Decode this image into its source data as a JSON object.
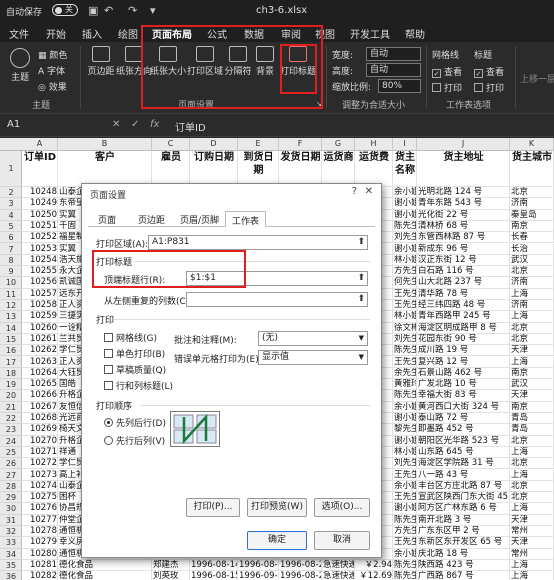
{
  "title_bar": {
    "autosave_label": "自动保存",
    "toggle_state": "关",
    "filename": "ch3-6.xlsx"
  },
  "tabs": [
    "文件",
    "开始",
    "插入",
    "绘图",
    "页面布局",
    "公式",
    "数据",
    "审阅",
    "视图",
    "开发工具",
    "帮助"
  ],
  "active_tab": "页面布局",
  "ribbon": {
    "theme_group": {
      "label": "主题",
      "buttons": [
        "主题",
        "颜色",
        "字体",
        "效果"
      ]
    },
    "page_setup_group": {
      "label": "页面设置",
      "buttons": [
        "页边距",
        "纸张方向",
        "纸张大小",
        "打印区域",
        "分隔符",
        "背景",
        "打印标题"
      ]
    },
    "scale_group": {
      "label": "调整为合适大小",
      "width_label": "宽度:",
      "width_value": "自动",
      "height_label": "高度:",
      "height_value": "自动",
      "scale_label": "缩放比例:",
      "scale_value": "80%"
    },
    "sheet_options_group": {
      "label": "工作表选项",
      "gridlines": "网格线",
      "headings": "标题",
      "view1": "查看",
      "view2": "查看",
      "print1": "打印",
      "print2": "打印"
    },
    "arrange": "上移一层"
  },
  "formula_bar": {
    "name_box": "A1",
    "fx": "fx",
    "value": "订单ID"
  },
  "columns": [
    "A",
    "B",
    "C",
    "D",
    "E",
    "F",
    "G",
    "H",
    "I",
    "J",
    "K"
  ],
  "header_row": [
    "订单ID",
    "客户",
    "雇员",
    "订购日期",
    "到货日期",
    "发货日期",
    "运货商",
    "运货费",
    "货主名称",
    "货主地址",
    "货主城市"
  ],
  "rows": [
    [
      "10248",
      "山泰企业",
      "",
      "",
      "",
      "",
      "",
      "",
      "余小姐",
      "光明北路 124 号",
      "北京"
    ],
    [
      "10249",
      "东帝望",
      "",
      "",
      "",
      "",
      "",
      "",
      "谢小姐",
      "青年东路 543 号",
      "济南"
    ],
    [
      "10250",
      "实翼",
      "",
      "",
      "",
      "",
      "",
      "",
      "谢小姐",
      "光化街 22 号",
      "秦皇岛"
    ],
    [
      "10251",
      "千固",
      "",
      "",
      "",
      "",
      "",
      "",
      "陈先生",
      "清林桥 68 号",
      "南京"
    ],
    [
      "10252",
      "福星制衣",
      "",
      "",
      "",
      "",
      "",
      "",
      "刘先生",
      "东管西林路 87 号",
      "长春"
    ],
    [
      "10253",
      "实翼",
      "",
      "",
      "",
      "",
      "",
      "",
      "谢小姐",
      "新成东 96 号",
      "长治"
    ],
    [
      "10254",
      "浩天旅行",
      "",
      "",
      "",
      "",
      "",
      "",
      "林小姐",
      "汉正东街 12 号",
      "武汉"
    ],
    [
      "10255",
      "永大企业",
      "",
      "",
      "",
      "",
      "",
      "",
      "方先生",
      "白石路 116 号",
      "北京"
    ],
    [
      "10256",
      "凯诚国际",
      "",
      "",
      "",
      "",
      "",
      "",
      "何先生",
      "山大北路 237 号",
      "济南"
    ],
    [
      "10257",
      "远东开发",
      "",
      "",
      "",
      "",
      "",
      "",
      "王先生",
      "清华路 78 号",
      "上海"
    ],
    [
      "10258",
      "正人资源",
      "",
      "",
      "",
      "",
      "",
      "",
      "王先生",
      "经三纬四路 48 号",
      "济南"
    ],
    [
      "10259",
      "三捷实业",
      "",
      "",
      "",
      "",
      "",
      "",
      "林小姐",
      "青年西路甲 245 号",
      "上海"
    ],
    [
      "10260",
      "一诠精密",
      "",
      "",
      "",
      "",
      "",
      "",
      "徐文彬",
      "海淀区明成路甲 8 号",
      "北京"
    ],
    [
      "10261",
      "兰共贸易",
      "",
      "",
      "",
      "",
      "",
      "",
      "刘先生",
      "花园东街 90 号",
      "北京"
    ],
    [
      "10262",
      "学仁贸易",
      "",
      "",
      "",
      "",
      "",
      "",
      "陈先生",
      "成川路 19 号",
      "天津"
    ],
    [
      "10263",
      "正人资源",
      "",
      "",
      "",
      "",
      "",
      "",
      "王先生",
      "复兴路 12 号",
      "上海"
    ],
    [
      "10264",
      "大钰贸易",
      "",
      "",
      "",
      "",
      "",
      "",
      "余先生",
      "石景山路 462 号",
      "南京"
    ],
    [
      "10265",
      "国皓",
      "",
      "",
      "",
      "",
      "",
      "",
      "黄雅玲",
      "广发北路 10 号",
      "武汉"
    ],
    [
      "10266",
      "升格企业",
      "",
      "",
      "",
      "",
      "",
      "",
      "陈先生",
      "幸福大街 83 号",
      "天津"
    ],
    [
      "10267",
      "友恒信托",
      "",
      "",
      "",
      "",
      "",
      "",
      "余小姐",
      "黄河西口大街 324 号",
      "南京"
    ],
    [
      "10268",
      "光远商贸",
      "",
      "",
      "",
      "",
      "",
      "",
      "谢小姐",
      "泰山路 72 号",
      "青岛"
    ],
    [
      "10269",
      "椅天文化",
      "",
      "",
      "",
      "",
      "",
      "",
      "黎先生",
      "即墨路 452 号",
      "青岛"
    ],
    [
      "10270",
      "升格企业",
      "",
      "",
      "",
      "",
      "",
      "",
      "谢小姐",
      "朝阳区光华路 523 号",
      "北京"
    ],
    [
      "10271",
      "祥通",
      "",
      "",
      "",
      "",
      "",
      "",
      "林小姐",
      "山东路 645 号",
      "上海"
    ],
    [
      "10272",
      "学仁贸易",
      "",
      "",
      "",
      "",
      "",
      "",
      "刘先生",
      "海淀区学院路 31 号",
      "北京"
    ],
    [
      "10273",
      "高上补子",
      "",
      "",
      "",
      "",
      "",
      "",
      "王先生",
      "八一路 43 号",
      "上海"
    ],
    [
      "10274",
      "山泰企业",
      "",
      "",
      "",
      "",
      "",
      "",
      "余小姐",
      "丰台区方庄北路 87 号",
      "北京"
    ],
    [
      "10275",
      "困杯",
      "",
      "",
      "",
      "",
      "",
      "",
      "王先生",
      "宣武区陕西门东大街 45 号",
      "北京"
    ],
    [
      "10276",
      "协昌规能",
      "",
      "",
      "",
      "",
      "",
      "",
      "谢小姐",
      "阿方区广林东路 6 号",
      "上海"
    ],
    [
      "10277",
      "仲堂企业",
      "",
      "",
      "",
      "",
      "",
      "",
      "陈先生",
      "南开北路 3 号",
      "天津"
    ],
    [
      "10278",
      "通恒机械",
      "",
      "",
      "",
      "",
      "",
      "",
      "方先生",
      "广东东区甲 2 号",
      "常州"
    ],
    [
      "10279",
      "幸义房屋",
      "",
      "",
      "",
      "",
      "",
      "",
      "王先生",
      "东新区东开发区 65 号",
      "天津"
    ],
    [
      "10280",
      "通恒机械",
      "",
      "",
      "",
      "",
      "",
      "",
      "余小姐",
      "庆北路 18 号",
      "常州"
    ],
    [
      "10281",
      "德化食品",
      "郑建杰",
      "1996-08-14",
      "1996-08-28",
      "1996-08-21",
      "急速快递",
      "￥2.94",
      "陈先生",
      "陕西路 423 号",
      "上海"
    ],
    [
      "10282",
      "德化食品",
      "刘英玫",
      "1996-08-15",
      "1996-09-12",
      "1996-08-21",
      "急速快递",
      "￥12.69",
      "陈先生",
      "广西路 867 号",
      "上海"
    ],
    [
      "10283",
      "富泰人寿",
      "李芳",
      "1996-08-16",
      "1996-09-13",
      "1996-08-23",
      "联邦货运",
      "￥84.81",
      "陈玉美",
      "冀北路 23 号",
      "上海"
    ]
  ],
  "dialog": {
    "title": "页面设置",
    "help": "?",
    "close": "✕",
    "tabs": [
      "页面",
      "页边距",
      "页眉/页脚",
      "工作表"
    ],
    "active_tab": "工作表",
    "print_area_label": "打印区域(A):",
    "print_area_value": "A1:P831",
    "print_titles_label": "打印标题",
    "top_rows_label": "顶端标题行(R):",
    "top_rows_value": "$1:$1",
    "left_cols_label": "从左侧重复的列数(C):",
    "left_cols_value": "",
    "print_section": "打印",
    "gridlines": "网格线(G)",
    "mono": "单色打印(B)",
    "draft": "草稿质量(Q)",
    "rowcol_headings": "行和列标题(L)",
    "comments_label": "批注和注释(M):",
    "comments_value": "(无)",
    "errors_label": "错误单元格打印为(E):",
    "errors_value": "显示值",
    "order_section": "打印顺序",
    "down_then_over": "先列后行(D)",
    "over_then_down": "先行后列(V)",
    "print_btn": "打印(P)...",
    "preview_btn": "打印预览(W)",
    "options_btn": "选项(O)...",
    "ok_btn": "确定",
    "cancel_btn": "取消"
  },
  "colors": {
    "excel_dark": "#1f1f1f",
    "ribbon": "#2b2b2b",
    "highlight_red": "#e02020",
    "accent_green": "#5ea56a",
    "dialog_blue": "#2c6fd1"
  }
}
